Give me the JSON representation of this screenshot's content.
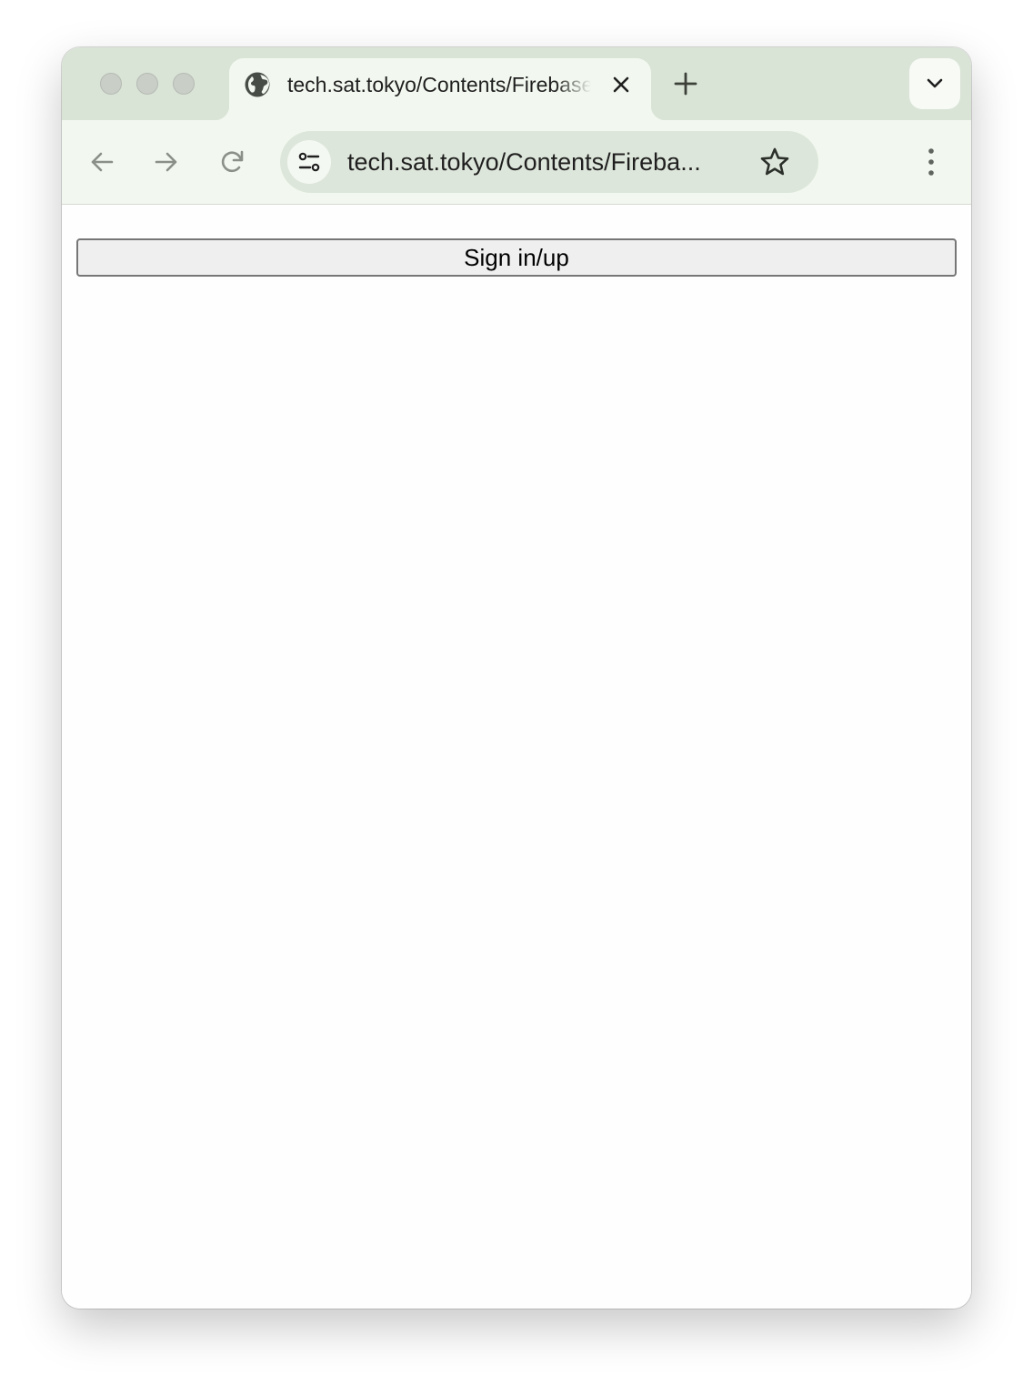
{
  "tab": {
    "title": "tech.sat.tokyo/Contents/Firebase",
    "favicon": "globe-icon",
    "close_icon": "close-icon"
  },
  "toolbar": {
    "new_tab_icon": "plus-icon",
    "tab_search_icon": "chevron-down-icon",
    "back_icon": "arrow-left-icon",
    "forward_icon": "arrow-right-icon",
    "reload_icon": "reload-icon",
    "site_info_icon": "tune-icon",
    "url": "tech.sat.tokyo/Contents/Fireba...",
    "bookmark_icon": "star-icon",
    "menu_icon": "kebab-menu-icon"
  },
  "page": {
    "signin_label": "Sign in/up"
  },
  "colors": {
    "titlebar": "#d9e3d6",
    "toolbar": "#f2f8ef",
    "omnibox": "#dde6da",
    "button_bg": "#efefef",
    "button_border": "#767676"
  }
}
